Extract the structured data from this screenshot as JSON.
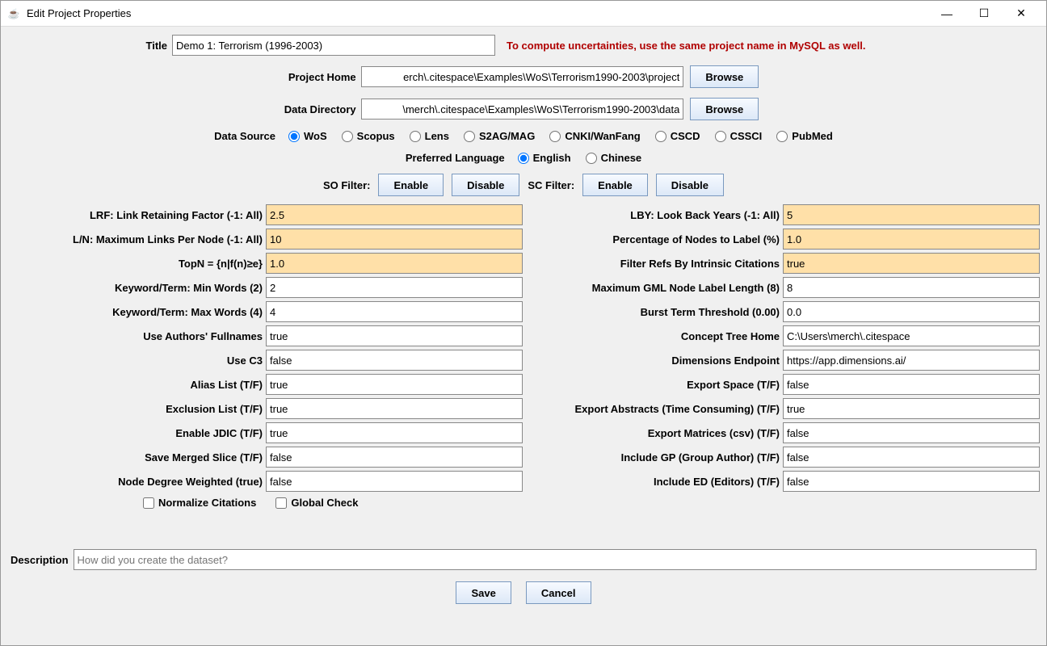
{
  "window": {
    "title": "Edit Project Properties"
  },
  "title": {
    "label": "Title",
    "value": "Demo 1: Terrorism (1996-2003)"
  },
  "warning": "To compute uncertainties, use the same project name in MySQL as well.",
  "projectHome": {
    "label": "Project Home",
    "value": "erch\\.citespace\\Examples\\WoS\\Terrorism1990-2003\\project",
    "browse": "Browse"
  },
  "dataDirectory": {
    "label": "Data Directory",
    "value": "\\merch\\.citespace\\Examples\\WoS\\Terrorism1990-2003\\data",
    "browse": "Browse"
  },
  "dataSource": {
    "label": "Data Source",
    "options": [
      "WoS",
      "Scopus",
      "Lens",
      "S2AG/MAG",
      "CNKI/WanFang",
      "CSCD",
      "CSSCI",
      "PubMed"
    ],
    "selected": "WoS"
  },
  "preferredLanguage": {
    "label": "Preferred Language",
    "options": [
      "English",
      "Chinese"
    ],
    "selected": "English"
  },
  "soFilter": {
    "label": "SO Filter:",
    "enable": "Enable",
    "disable": "Disable"
  },
  "scFilter": {
    "label": "SC Filter:",
    "enable": "Enable",
    "disable": "Disable"
  },
  "left": {
    "lrf": {
      "label": "LRF: Link Retaining Factor (-1: All)",
      "value": "2.5",
      "hl": true
    },
    "ln": {
      "label": "L/N: Maximum Links Per Node (-1: All)",
      "value": "10",
      "hl": true
    },
    "topn": {
      "label": "TopN = {n|f(n)≥e}",
      "value": "1.0",
      "hl": true
    },
    "minw": {
      "label": "Keyword/Term: Min Words (2)",
      "value": "2"
    },
    "maxw": {
      "label": "Keyword/Term: Max Words (4)",
      "value": "4"
    },
    "fulln": {
      "label": "Use Authors' Fullnames",
      "value": "true"
    },
    "usec3": {
      "label": "Use C3",
      "value": "false"
    },
    "alias": {
      "label": "Alias List (T/F)",
      "value": "true"
    },
    "excl": {
      "label": "Exclusion List (T/F)",
      "value": "true"
    },
    "jdic": {
      "label": "Enable JDIC (T/F)",
      "value": "true"
    },
    "merged": {
      "label": "Save Merged Slice (T/F)",
      "value": "false"
    },
    "degw": {
      "label": "Node Degree Weighted (true)",
      "value": "false"
    }
  },
  "right": {
    "lby": {
      "label": "LBY: Look Back Years (-1: All)",
      "value": "5",
      "hl": true
    },
    "pct": {
      "label": "Percentage of Nodes to Label (%)",
      "value": "1.0",
      "hl": true
    },
    "intr": {
      "label": "Filter Refs By Intrinsic Citations",
      "value": "true",
      "hl": true
    },
    "gml": {
      "label": "Maximum GML Node Label Length (8)",
      "value": "8"
    },
    "burst": {
      "label": "Burst Term Threshold (0.00)",
      "value": "0.0"
    },
    "ctree": {
      "label": "Concept Tree Home",
      "value": "C:\\Users\\merch\\.citespace"
    },
    "dims": {
      "label": "Dimensions Endpoint",
      "value": "https://app.dimensions.ai/"
    },
    "espace": {
      "label": "Export Space (T/F)",
      "value": "false"
    },
    "eabs": {
      "label": "Export Abstracts (Time Consuming) (T/F)",
      "value": "true"
    },
    "emat": {
      "label": "Export Matrices (csv) (T/F)",
      "value": "false"
    },
    "igp": {
      "label": "Include GP (Group Author) (T/F)",
      "value": "false"
    },
    "ied": {
      "label": "Include ED (Editors) (T/F)",
      "value": "false"
    }
  },
  "checks": {
    "normalize": "Normalize Citations",
    "global": "Global Check"
  },
  "description": {
    "label": "Description",
    "placeholder": "How did you create the dataset?"
  },
  "footer": {
    "save": "Save",
    "cancel": "Cancel"
  }
}
